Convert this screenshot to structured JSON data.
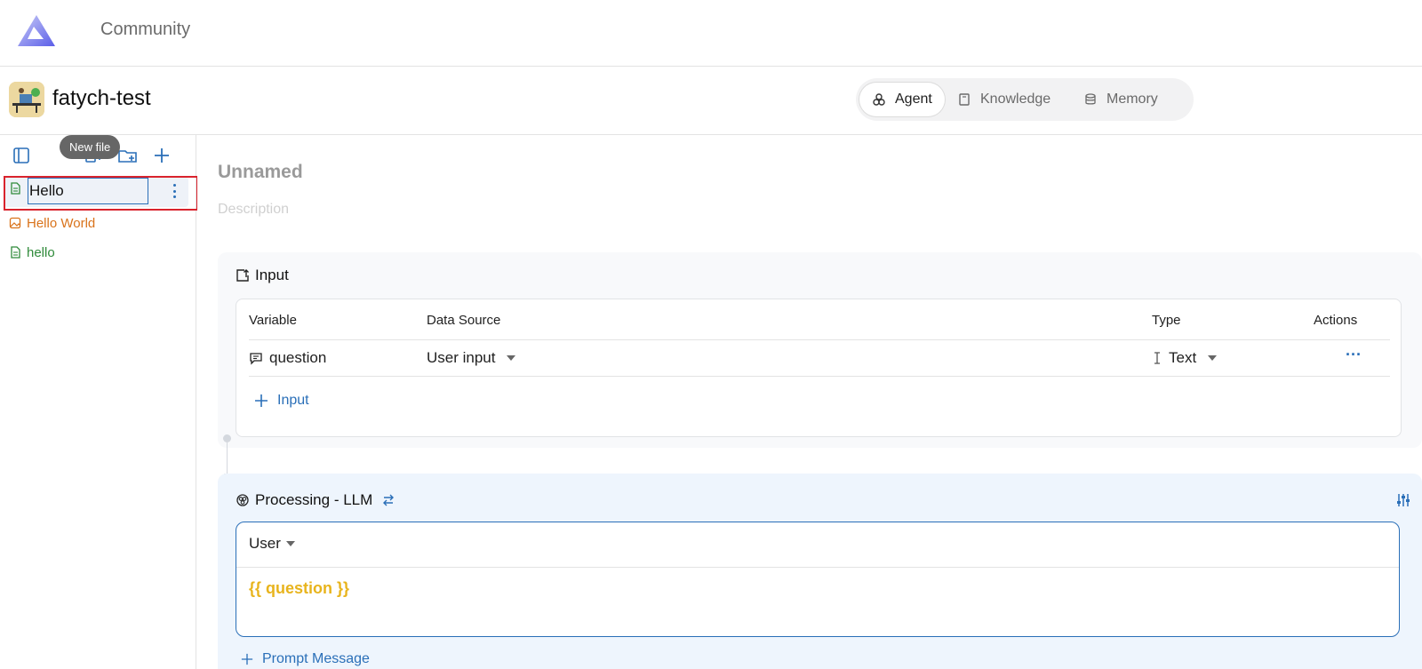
{
  "topbar": {
    "community_label": "Community"
  },
  "project": {
    "name": "fatych-test"
  },
  "tabs": [
    {
      "label": "Agent",
      "icon": "agent-icon",
      "active": true
    },
    {
      "label": "Knowledge",
      "icon": "book-icon",
      "active": false
    },
    {
      "label": "Memory",
      "icon": "database-icon",
      "active": false
    }
  ],
  "sidebar": {
    "tooltip": "New file",
    "rename_value": "Hello",
    "items": [
      {
        "label": "Hello World",
        "icon": "image-file-icon",
        "color": "#d9731b"
      },
      {
        "label": "hello",
        "icon": "text-file-icon",
        "color": "#2f8a3a"
      }
    ]
  },
  "agent": {
    "title": "Unnamed",
    "description_placeholder": "Description"
  },
  "input_section": {
    "title": "Input",
    "columns": {
      "variable": "Variable",
      "data_source": "Data Source",
      "type": "Type",
      "actions": "Actions"
    },
    "row": {
      "variable": "question",
      "data_source": "User input",
      "type": "Text",
      "actions": "···"
    },
    "add_label": "Input"
  },
  "processing_section": {
    "title": "Processing - LLM",
    "role": "User",
    "prompt_text": "{{ question }}",
    "add_label": "Prompt Message"
  },
  "colors": {
    "accent": "#2a6fb8",
    "highlight": "#d9232d",
    "variable": "#e8b41d"
  }
}
